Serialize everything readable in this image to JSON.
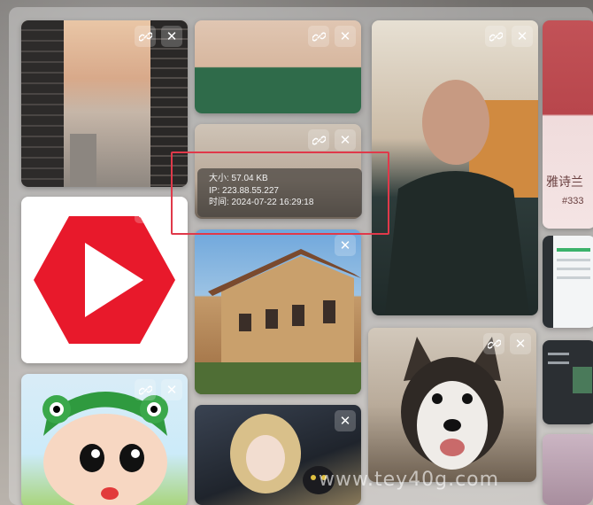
{
  "gallery": {
    "cards": [
      {
        "id": "city"
      },
      {
        "id": "hexagon"
      },
      {
        "id": "crayon"
      },
      {
        "id": "woman1"
      },
      {
        "id": "woman2"
      },
      {
        "id": "villa"
      },
      {
        "id": "anime"
      },
      {
        "id": "man"
      },
      {
        "id": "husky"
      },
      {
        "id": "lips"
      },
      {
        "id": "ui"
      },
      {
        "id": "ui-dark"
      },
      {
        "id": "misc"
      }
    ]
  },
  "tooltip": {
    "size": "大小: 57.04 KB",
    "ip": "IP: 223.88.55.227",
    "time": "时间: 2024-07-22 16:29:18"
  },
  "lips_text": {
    "line1": "雅诗兰",
    "line2": "#333"
  },
  "watermark": "www.tey40g.com",
  "icons": {
    "link": "link-icon",
    "close": "close-icon"
  },
  "colors": {
    "highlight": "#e0394a",
    "hexagon": "#e8192b"
  }
}
